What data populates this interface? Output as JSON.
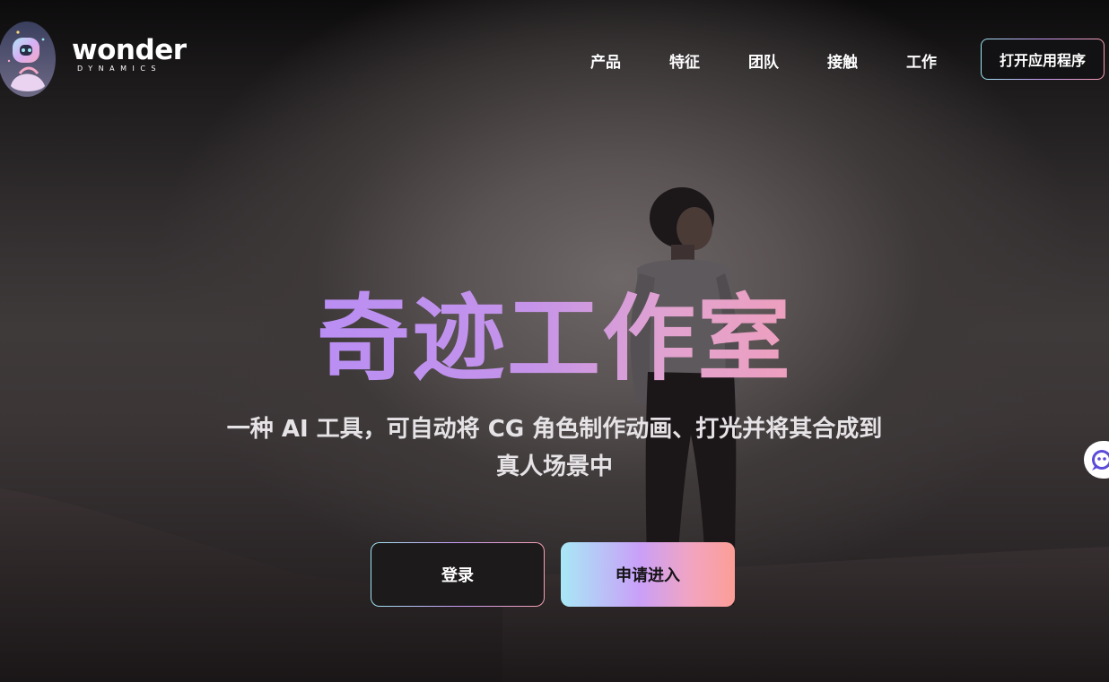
{
  "brand": {
    "name": "wonder",
    "sub": "DYNAMICS"
  },
  "nav": {
    "items": [
      "产品",
      "特征",
      "团队",
      "接触",
      "工作"
    ],
    "open_app_label": "打开应用程序"
  },
  "hero": {
    "headline": "奇迹工作室",
    "subtitle_line1": "一种 AI 工具，可自动将 CG 角色制作动画、打光并将其合成到",
    "subtitle_line2": "真人场景中"
  },
  "cta": {
    "login_label": "登录",
    "apply_label": "申请进入"
  },
  "icons": {
    "logo": "robot-mascot-icon",
    "chat": "chat-bot-icon"
  },
  "colors": {
    "headline_gradient_start": "#b98ef3",
    "headline_gradient_end": "#ee9fbe",
    "cta_gradient": [
      "#a8e8f6",
      "#c9a0f8",
      "#f2a4c0",
      "#fc9e96"
    ],
    "background": "#2e2a2b"
  }
}
